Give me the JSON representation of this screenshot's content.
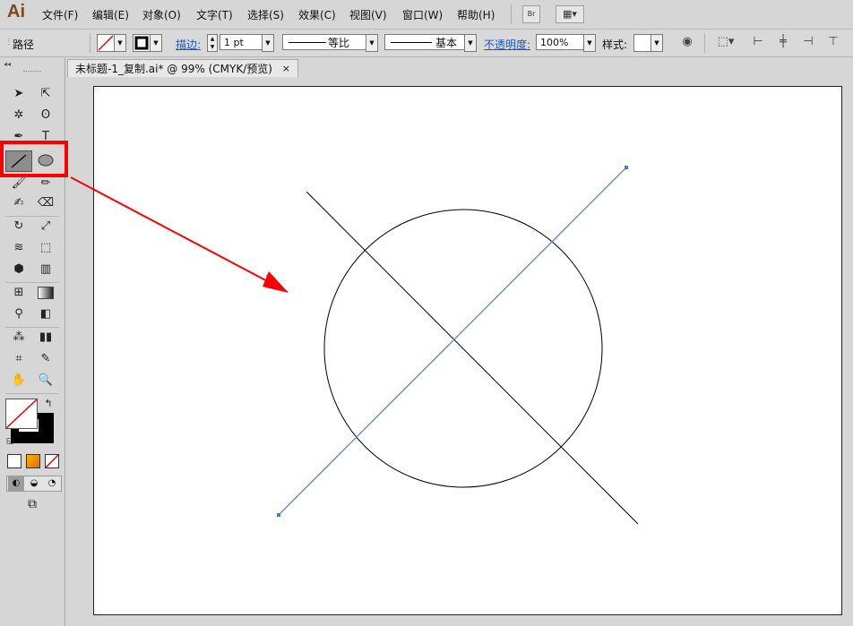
{
  "app": {
    "logo": "Ai"
  },
  "menu": [
    "文件(F)",
    "编辑(E)",
    "对象(O)",
    "文字(T)",
    "选择(S)",
    "效果(C)",
    "视图(V)",
    "窗口(W)",
    "帮助(H)"
  ],
  "menu_buttons": {
    "bridge": "Br"
  },
  "control_bar": {
    "selection_label": "路径",
    "stroke_label": "描边:",
    "stroke_weight": "1 pt",
    "profile_label": "等比",
    "brush_label": "基本",
    "opacity_label": "不透明度:",
    "opacity_value": "100%",
    "style_label": "样式:"
  },
  "document_tab": {
    "title": "未标题-1_复制.ai* @ 99% (CMYK/预览)",
    "close": "×"
  },
  "tools": {
    "highlight_color": "#ff0000",
    "active_tool": "line-segment-tool"
  },
  "colors": {
    "selection_blue": "#6f8fd0",
    "artwork_black": "#000000",
    "annotation_red": "#ff0000"
  }
}
